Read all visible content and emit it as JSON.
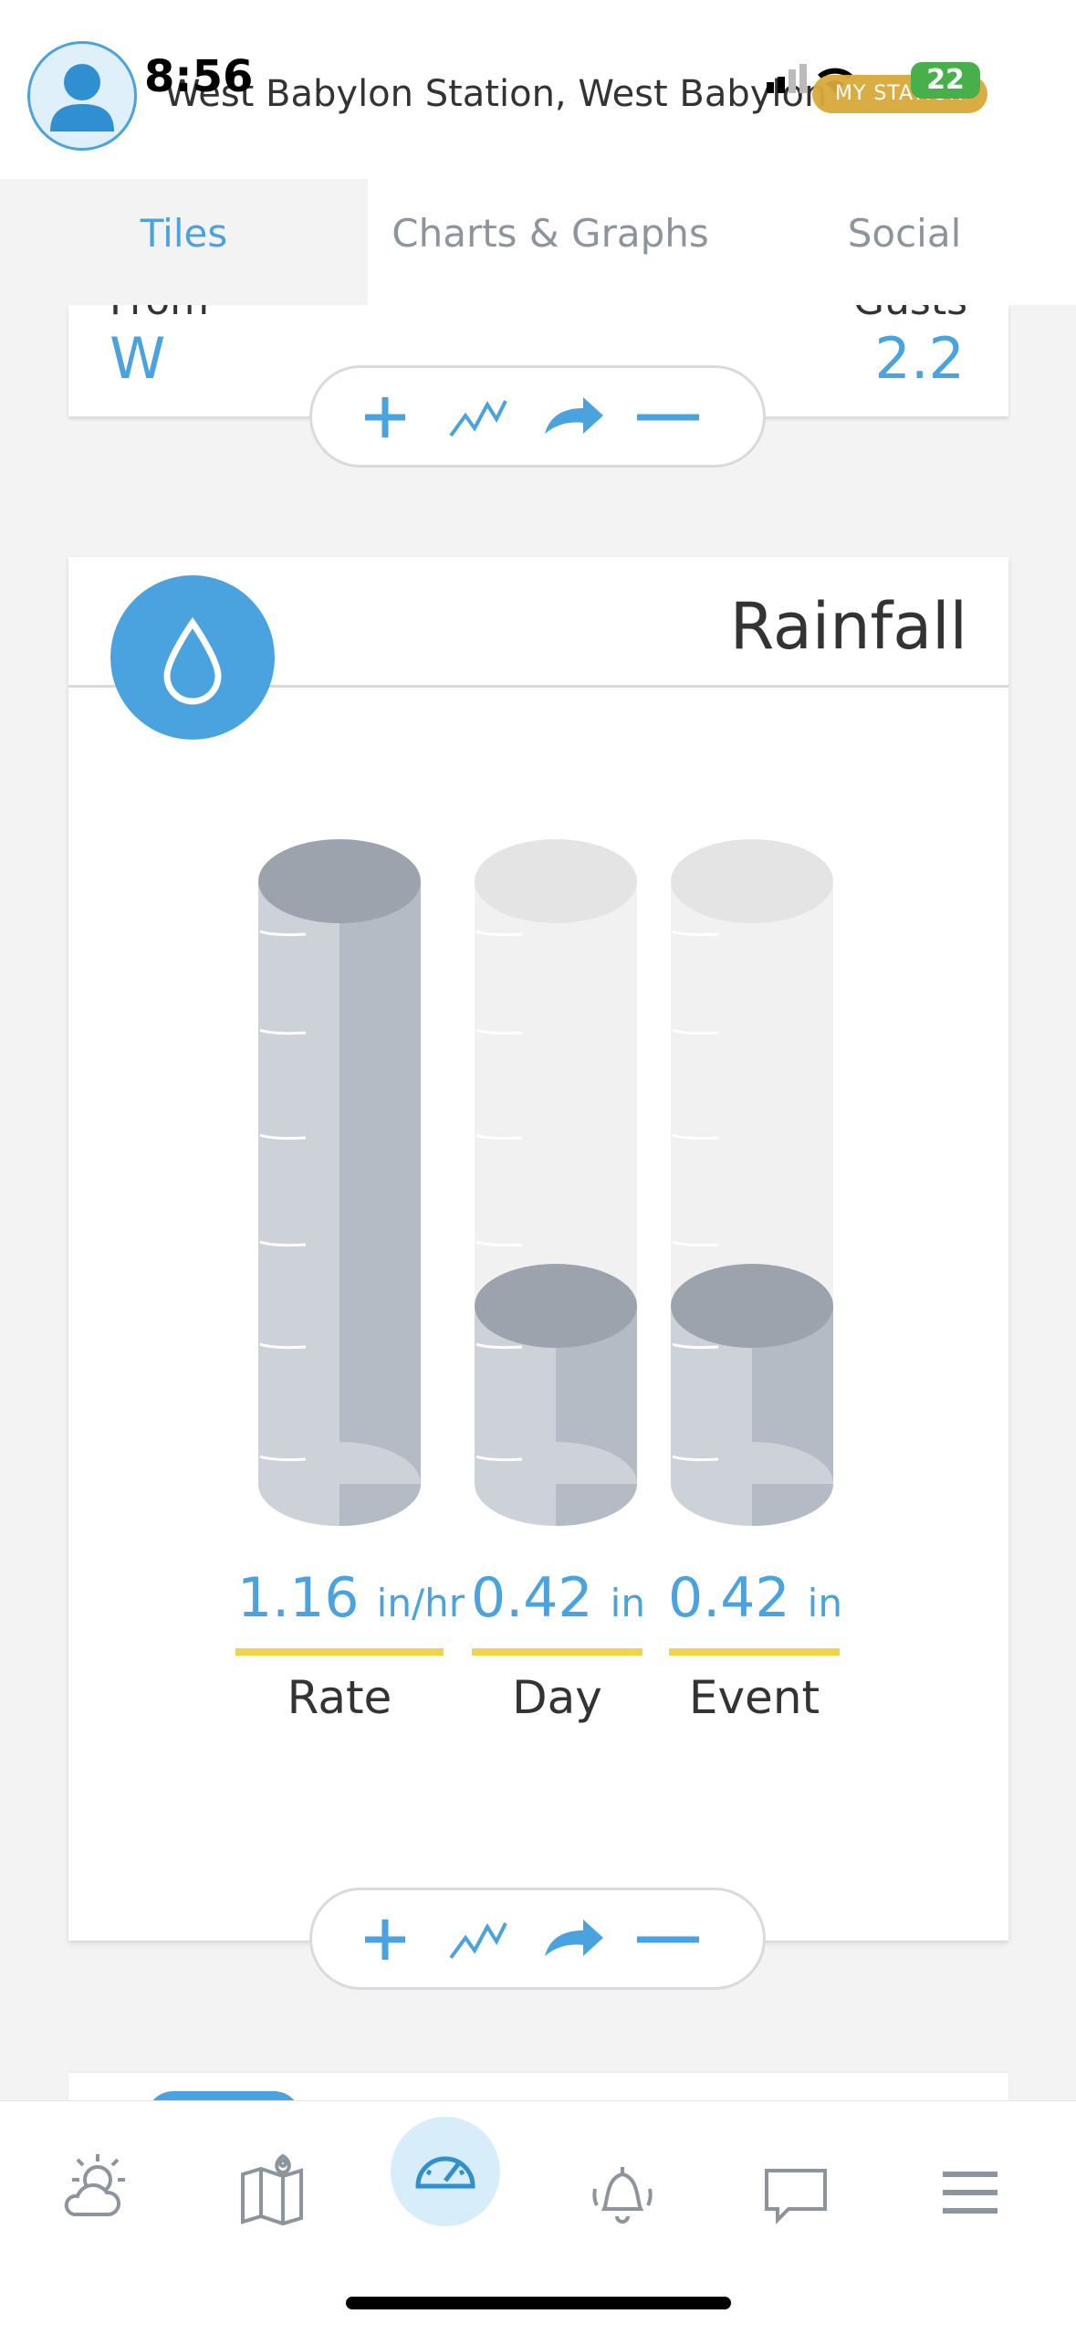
{
  "status_bar": {
    "time": "8:56",
    "battery": "22"
  },
  "header": {
    "station_name": "West Babylon Station, West Babylon",
    "badge": "MY STATION"
  },
  "tabs": [
    {
      "label": "Tiles",
      "active": true
    },
    {
      "label": "Charts & Graphs",
      "active": false
    },
    {
      "label": "Social",
      "active": false
    }
  ],
  "wind_card": {
    "from_label": "From",
    "gusts_label": "Gusts",
    "direction": "W",
    "gust_value": "2.2"
  },
  "rainfall": {
    "title": "Rainfall",
    "gauges": [
      {
        "label": "Rate",
        "value": "1.16",
        "unit": "in/hr",
        "fill": 1.0
      },
      {
        "label": "Day",
        "value": "0.42",
        "unit": "in",
        "fill": 0.33
      },
      {
        "label": "Event",
        "value": "0.42",
        "unit": "in",
        "fill": 0.33
      }
    ]
  },
  "tile_actions": [
    "add-icon",
    "chart-icon",
    "share-icon",
    "remove-icon"
  ],
  "bottom_nav": [
    {
      "name": "forecast",
      "icon": "weather-icon"
    },
    {
      "name": "map",
      "icon": "map-icon"
    },
    {
      "name": "dashboard",
      "icon": "gauge-icon",
      "active": true
    },
    {
      "name": "alerts",
      "icon": "bell-icon"
    },
    {
      "name": "messages",
      "icon": "chat-icon"
    },
    {
      "name": "menu",
      "icon": "menu-icon"
    }
  ],
  "colors": {
    "accent": "#4aa3de",
    "badge": "#d9a93a",
    "underline": "#f2d44b"
  }
}
